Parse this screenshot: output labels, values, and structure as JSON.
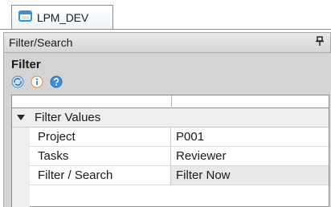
{
  "tab": {
    "label": "LPM_DEV",
    "icon": "window-tab-icon"
  },
  "panel": {
    "title": "Filter/Search",
    "pin_label": "ᴨ",
    "pin_icon": "pin-icon"
  },
  "filter": {
    "title": "Filter",
    "toolbar_icons": [
      "refresh-icon",
      "info-icon",
      "help-icon"
    ]
  },
  "property_grid": {
    "category": "Filter Values",
    "rows": [
      {
        "name": "Project",
        "value": "P001"
      },
      {
        "name": "Tasks",
        "value": "Reviewer"
      },
      {
        "name": "Filter / Search",
        "value": "Filter Now"
      }
    ]
  },
  "colors": {
    "accent": "#3a8fd8",
    "frame": "#d4d4d4",
    "header": "#dcdcdc"
  }
}
